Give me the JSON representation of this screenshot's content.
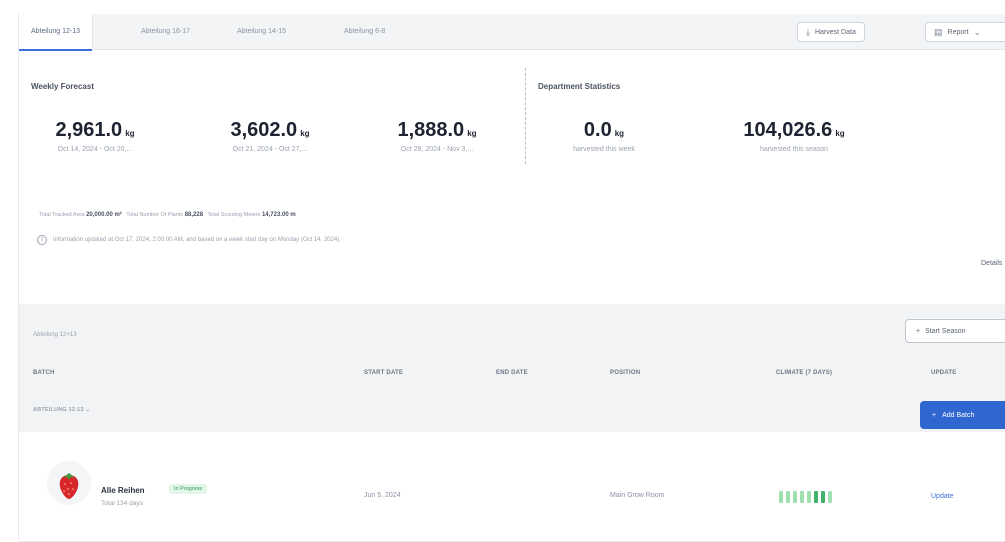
{
  "tabs": [
    {
      "label": "Abteilung 12-13",
      "active": true
    },
    {
      "label": "Abteilung 16-17",
      "active": false
    },
    {
      "label": "Abteilung 14-15",
      "active": false
    },
    {
      "label": "Abteilung 6-8",
      "active": false
    }
  ],
  "toolbar": {
    "harvest_label": "Harvest Data",
    "report_label": "Report"
  },
  "forecast": {
    "title": "Weekly Forecast",
    "items": [
      {
        "value": "2,961.0",
        "unit": "kg",
        "range": "Oct 14, 2024 - Oct 20,..."
      },
      {
        "value": "3,602.0",
        "unit": "kg",
        "range": "Oct 21, 2024 - Oct 27,..."
      },
      {
        "value": "1,888.0",
        "unit": "kg",
        "range": "Oct 28, 2024 - Nov 3,..."
      }
    ]
  },
  "stats": {
    "title": "Department Statistics",
    "items": [
      {
        "value": "0.0",
        "unit": "kg",
        "label": "harvested this week"
      },
      {
        "value": "104,026.6",
        "unit": "kg",
        "label": "harvested this season"
      }
    ]
  },
  "totals": {
    "area_label": "Total Tracked Area",
    "area_value": "20,000.00 m²",
    "plants_label": "Total Number Of Plants",
    "plants_value": "88,228",
    "meters_label": "Total Scouting Meters",
    "meters_value": "14,723.00 m"
  },
  "info_text": "Information updated at Oct 17, 2024, 2:00:00 AM, and based on a week start day on Monday (Oct 14, 2024).",
  "details_label": "Details",
  "department": {
    "name": "Abteilung 12+13",
    "start_season_label": "Start Season"
  },
  "table": {
    "headers": [
      "BATCH",
      "START DATE",
      "END DATE",
      "POSITION",
      "CLIMATE (7 DAYS)",
      "UPDATE"
    ],
    "group_label": "ABTEILUNG 12-13",
    "add_batch_label": "Add Batch",
    "rows": [
      {
        "name": "Alle Reihen",
        "status": "In Progress",
        "duration": "Total 134 days",
        "start_date": "Jun 5, 2024",
        "end_date": "",
        "position": "Main Grow Room",
        "climate": [
          1,
          1,
          1,
          1,
          1,
          2,
          2,
          1
        ],
        "update_label": "Update"
      }
    ]
  },
  "colors": {
    "accent": "#3b6fd8",
    "add_button": "#2f66d0",
    "status_green": "#2f9d55",
    "climate_light": "#9fe0b0",
    "climate_dark": "#3fb36a"
  }
}
